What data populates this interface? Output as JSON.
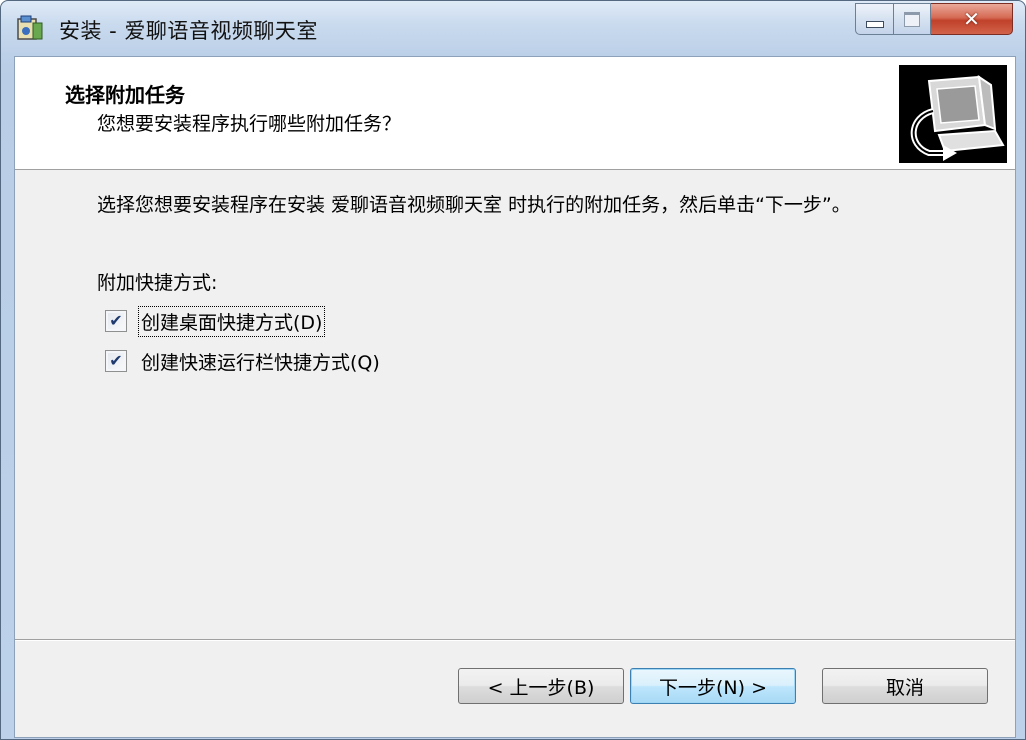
{
  "window": {
    "title": "安装 - 爱聊语音视频聊天室",
    "minimize_icon": "minimize-icon",
    "maximize_icon": "maximize-icon",
    "close_glyph": "✕"
  },
  "header": {
    "title": "选择附加任务",
    "subtitle": "您想要安装程序执行哪些附加任务？",
    "image_icon": "computer-install-icon"
  },
  "body": {
    "description": "选择您想要安装程序在安装 爱聊语音视频聊天室 时执行的附加任务，然后单击“下一步”。",
    "group_label": "附加快捷方式:"
  },
  "tasks": [
    {
      "label": "创建桌面快捷方式(D)",
      "checked": true,
      "check_glyph": "✔"
    },
    {
      "label": "创建快速运行栏快捷方式(Q)",
      "checked": true,
      "check_glyph": "✔"
    }
  ],
  "buttons": {
    "back": "< 上一步(B)",
    "next": "下一步(N) >",
    "cancel": "取消"
  },
  "colors": {
    "titlebar": "#c9daee",
    "client_bg": "#f0f0f0",
    "close_button": "#c0412a"
  }
}
